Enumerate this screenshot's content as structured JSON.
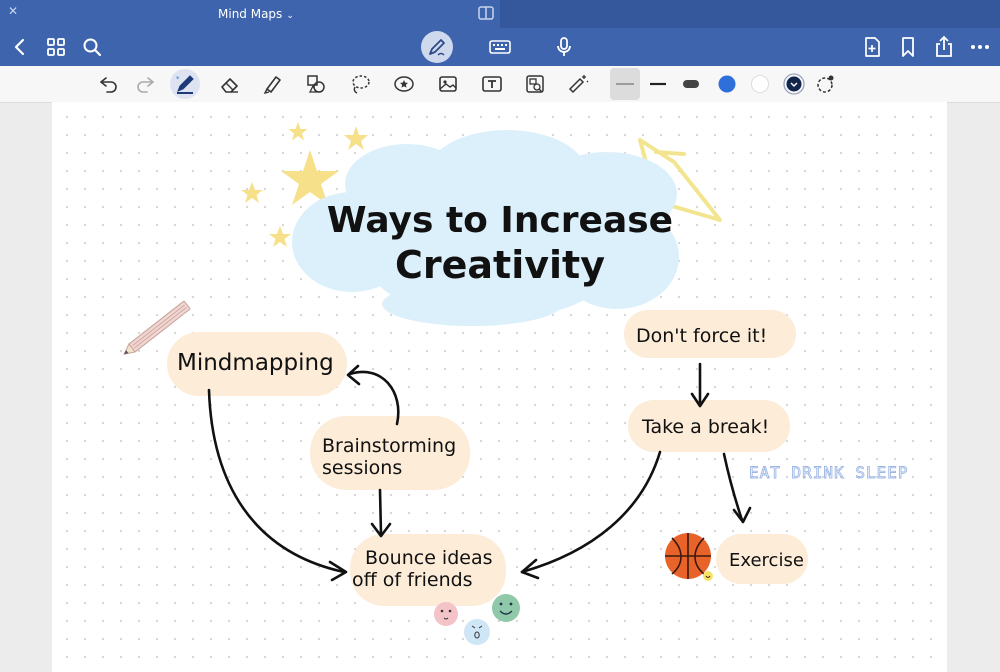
{
  "window": {
    "title": "Mind Maps"
  },
  "navbar": {
    "back_icon": "chevron-left-icon",
    "grid_icon": "grid-icon",
    "search_icon": "search-icon",
    "pen_mode_icon": "pen-mode-icon",
    "keyboard_icon": "keyboard-icon",
    "mic_icon": "microphone-icon",
    "add_page_icon": "add-page-icon",
    "bookmark_icon": "bookmark-icon",
    "share_icon": "share-icon",
    "more_icon": "more-icon"
  },
  "toolbar": {
    "tools": [
      "undo-icon",
      "redo-icon",
      "pen-icon",
      "eraser-icon",
      "highlighter-icon",
      "shapes-icon",
      "lasso-icon",
      "sticker-icon",
      "image-icon",
      "text-icon",
      "camera-icon",
      "laser-pointer-icon"
    ],
    "colors": {
      "accent": "#2f6fdc",
      "white": "#ffffff",
      "dark_navy": "#12254a"
    }
  },
  "canvas": {
    "title_line1": "Ways to Increase",
    "title_line2": "Creativity",
    "nodes": {
      "mindmapping": "Mindmapping",
      "brainstorm_line1": "Brainstorming",
      "brainstorm_line2": "sessions",
      "bounce_line1": "Bounce ideas",
      "bounce_line2": "off of friends",
      "dont_force": "Don't force it!",
      "take_break": "Take a break!",
      "exercise": "Exercise"
    },
    "annotation": "EAT DRINK SLEEP",
    "colors": {
      "cloud": "#dcf0fb",
      "bubble": "#fcecd8",
      "star": "#f7e08a",
      "ink": "#111111"
    }
  }
}
